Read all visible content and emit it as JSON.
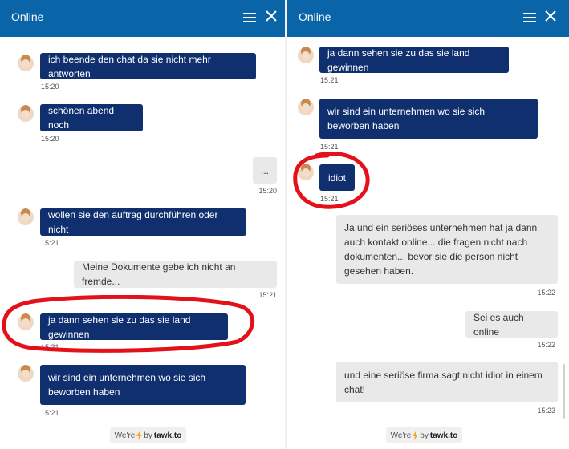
{
  "left": {
    "header": {
      "title": "Online"
    },
    "messages": [
      {
        "text": "ich beende den chat da sie nicht mehr antworten",
        "time": "15:20"
      },
      {
        "text": "schönen abend noch",
        "time": "15:20"
      },
      {
        "text": "...",
        "time": "15:20"
      },
      {
        "text": "wollen sie den auftrag durchführen oder nicht",
        "time": "15:21"
      },
      {
        "text": "Meine Dokumente gebe ich nicht an fremde...",
        "time": "15:21"
      },
      {
        "text": "ja dann sehen sie zu das sie land gewinnen",
        "time": "15:21"
      },
      {
        "text": "wir sind ein unternehmen wo sie sich beworben haben",
        "time": "15:21"
      }
    ],
    "footer": {
      "prefix": "We're",
      "by": "by",
      "brand": "tawk.to"
    }
  },
  "right": {
    "header": {
      "title": "Online"
    },
    "messages": [
      {
        "text": "ja dann sehen sie zu das sie land gewinnen",
        "time": "15:21"
      },
      {
        "text": "wir sind ein unternehmen wo sie sich beworben haben",
        "time": "15:21"
      },
      {
        "text": "idiot",
        "time": "15:21"
      },
      {
        "text": "Ja und ein seriöses unternehmen hat ja dann auch kontakt online... die fragen nicht nach dokumenten... bevor sie die person nicht gesehen haben.",
        "time": "15:22"
      },
      {
        "text": "Sei es auch online",
        "time": "15:22"
      },
      {
        "text": "und eine seriöse firma sagt nicht idiot in einem chat!",
        "time": "15:23"
      }
    ],
    "footer": {
      "prefix": "We're",
      "by": "by",
      "brand": "tawk.to"
    }
  },
  "colors": {
    "header_bg": "#0a64a8",
    "agent_bubble": "#0f2f6e",
    "visitor_bubble": "#e9e9e9",
    "highlight_ring": "#e3121a"
  },
  "icons": [
    "menu-icon",
    "close-icon",
    "avatar",
    "lightning-icon"
  ]
}
